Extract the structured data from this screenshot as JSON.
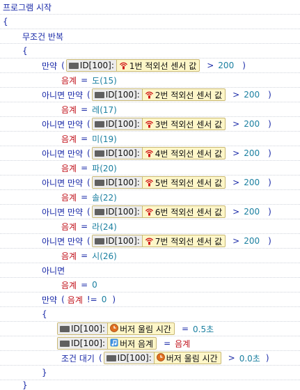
{
  "program": {
    "title": "프로그램 시작",
    "open_brace": "{",
    "close_brace": "}"
  },
  "loop": {
    "label": "무조건 반복",
    "open_brace": "{",
    "close_brace": "}"
  },
  "device_id": "ID[100]:",
  "sensors": [
    {
      "keyword": "만약",
      "open": "(",
      "sensor": "1번 적외선 센서 값",
      "op": ">",
      "value": "200",
      "close": ")",
      "assign_var": "음계",
      "assign_op": "=",
      "note": "도(15)"
    },
    {
      "keyword": "아니면 만약",
      "open": "(",
      "sensor": "2번 적외선 센서 값",
      "op": ">",
      "value": "200",
      "close": ")",
      "assign_var": "음계",
      "assign_op": "=",
      "note": "레(17)"
    },
    {
      "keyword": "아니면 만약",
      "open": "(",
      "sensor": "3번 적외선 센서 값",
      "op": ">",
      "value": "200",
      "close": ")",
      "assign_var": "음계",
      "assign_op": "=",
      "note": "미(19)"
    },
    {
      "keyword": "아니면 만약",
      "open": "(",
      "sensor": "4번 적외선 센서 값",
      "op": ">",
      "value": "200",
      "close": ")",
      "assign_var": "음계",
      "assign_op": "=",
      "note": "파(20)"
    },
    {
      "keyword": "아니면 만약",
      "open": "(",
      "sensor": "5번 적외선 센서 값",
      "op": ">",
      "value": "200",
      "close": ")",
      "assign_var": "음계",
      "assign_op": "=",
      "note": "솔(22)"
    },
    {
      "keyword": "아니면 만약",
      "open": "(",
      "sensor": "6번 적외선 센서 값",
      "op": ">",
      "value": "200",
      "close": ")",
      "assign_var": "음계",
      "assign_op": "=",
      "note": "라(24)"
    },
    {
      "keyword": "아니면 만약",
      "open": "(",
      "sensor": "7번 적외선 센서 값",
      "op": ">",
      "value": "200",
      "close": ")",
      "assign_var": "음계",
      "assign_op": "=",
      "note": "시(26)"
    }
  ],
  "else_block": {
    "keyword": "아니면",
    "assign_var": "음계",
    "assign_op": "=",
    "value": "0"
  },
  "if_note": {
    "keyword": "만약",
    "open": "(",
    "var": "음계",
    "op": "!=",
    "value": "0",
    "close": ")",
    "open_brace": "{",
    "close_brace": "}"
  },
  "buzzer_time": {
    "label": "버저 울림 시간",
    "op": "=",
    "value": "0.5초"
  },
  "buzzer_note": {
    "label": "버저 음계",
    "op": "=",
    "value": "음계"
  },
  "wait": {
    "keyword": "조건 대기",
    "open": "(",
    "label": "버저 울림 시간",
    "op": ">",
    "value": "0.0초",
    "close": ")"
  },
  "colors": {
    "keyword": "#1a2aa8",
    "variable": "#c0101a",
    "value": "#1a7fa0",
    "pill_bg": "#fdf6c8"
  }
}
